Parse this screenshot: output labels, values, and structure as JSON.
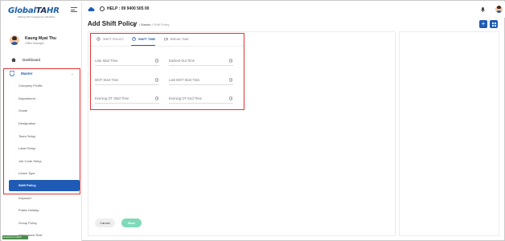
{
  "app": {
    "logo_main": "Global",
    "logo_ta": "TA",
    "logo_hr": "HR",
    "logo_tagline": "Making HR management effortless"
  },
  "topbar": {
    "help_text": "HELP : 09 9400 505 00",
    "icons": [
      "help-cloud-icon",
      "phone-icon",
      "bell-icon",
      "user-avatar-icon"
    ]
  },
  "user": {
    "name": "Kaung Myat Thu",
    "role": "Office Manager"
  },
  "sidebar": {
    "dashboard": "Dashboard",
    "master": "Master",
    "items": [
      "Company Profile",
      "Department",
      "Grade",
      "Designation",
      "Team Setup",
      "Label Setup",
      "Job Code Setup",
      "Leave Type",
      "Shift Policy",
      "Keyword",
      "Public Holiday",
      "Group Policy",
      "Attendance Rule"
    ],
    "active_item": "Shift Policy",
    "status_tag": "javascript:void(0)"
  },
  "page": {
    "title": "Add Shift Policy",
    "breadcrumb_master": "Master",
    "breadcrumb_separator": "/",
    "breadcrumb_current": "Shift Policy",
    "add_button": "+"
  },
  "tabs": {
    "shift_policy": "SHIFT POLICY",
    "shift_time": "SHIFT TIME",
    "break_time": "BREAK TIME",
    "active": "SHIFT TIME"
  },
  "fields": {
    "late_start_time": "Late Start Time",
    "earliest_out_time": "Earliest Out Time",
    "mot_start_time": "MOT Start Time",
    "last_mot_start_time": "Last MOT Start Time",
    "evening_ot_start_time": "Evening OT Start Time",
    "evening_ot_end_time": "Evening OT End Time"
  },
  "actions": {
    "cancel": "Cancel",
    "save": "Save"
  },
  "colors": {
    "primary": "#1f5bb5",
    "highlight_border": "#e23434",
    "save_button": "#7fdab8"
  }
}
